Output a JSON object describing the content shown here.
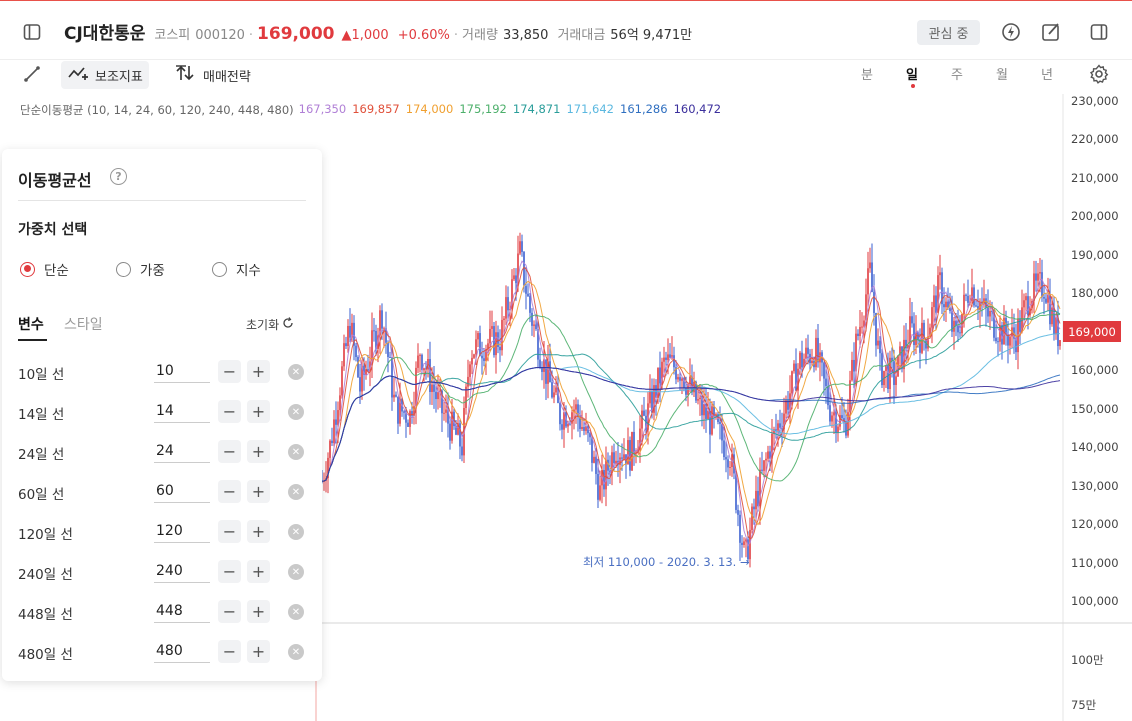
{
  "header": {
    "stock_name": "CJ대한통운",
    "market": "코스피",
    "code": "000120",
    "price": "169,000",
    "change": "▲1,000",
    "change_pct": "+0.60%",
    "volume_label": "거래량",
    "volume": "33,850",
    "amount_label": "거래대금",
    "amount": "56억 9,471만",
    "watch_label": "관심 중"
  },
  "toolbar": {
    "indicator_label": "보조지표",
    "strategy_label": "매매전략",
    "periods": [
      "분",
      "일",
      "주",
      "월",
      "년"
    ],
    "active_period": "일"
  },
  "legend": {
    "title": "단순이동평균 (10, 14, 24, 60, 120, 240, 448, 480)",
    "values": [
      {
        "value": "167,350",
        "color": "#b07fd6"
      },
      {
        "value": "169,857",
        "color": "#e0503a"
      },
      {
        "value": "174,000",
        "color": "#f0a030"
      },
      {
        "value": "175,192",
        "color": "#4caf6a"
      },
      {
        "value": "174,871",
        "color": "#2a9d9a"
      },
      {
        "value": "171,642",
        "color": "#5bb8e0"
      },
      {
        "value": "161,286",
        "color": "#2f6fc0"
      },
      {
        "value": "160,472",
        "color": "#3b2f9c"
      }
    ]
  },
  "panel": {
    "title": "이동평균선",
    "weight_title": "가중치 선택",
    "radios": [
      {
        "label": "단순",
        "checked": true
      },
      {
        "label": "가중",
        "checked": false
      },
      {
        "label": "지수",
        "checked": false
      }
    ],
    "tab_variables": "변수",
    "tab_style": "스타일",
    "reset_label": "초기화",
    "rows": [
      {
        "label": "10일 선",
        "value": "10"
      },
      {
        "label": "14일 선",
        "value": "14"
      },
      {
        "label": "24일 선",
        "value": "24"
      },
      {
        "label": "60일 선",
        "value": "60"
      },
      {
        "label": "120일 선",
        "value": "120"
      },
      {
        "label": "240일 선",
        "value": "240"
      },
      {
        "label": "448일 선",
        "value": "448"
      },
      {
        "label": "480일 선",
        "value": "480"
      }
    ]
  },
  "chart_data": {
    "type": "candlestick",
    "y_ticks": [
      "230,000",
      "220,000",
      "210,000",
      "200,000",
      "190,000",
      "180,000",
      "170,000",
      "160,000",
      "150,000",
      "140,000",
      "130,000",
      "120,000",
      "110,000",
      "100,000"
    ],
    "ylim": [
      100000,
      230000
    ],
    "current_price": "169,000",
    "min_annotation": "최저 110,000 - 2020. 3. 13. →",
    "volume_ticks": [
      "100만",
      "75만"
    ],
    "candle_color_up": "#e03a3e",
    "candle_color_down": "#3a5fd0"
  }
}
